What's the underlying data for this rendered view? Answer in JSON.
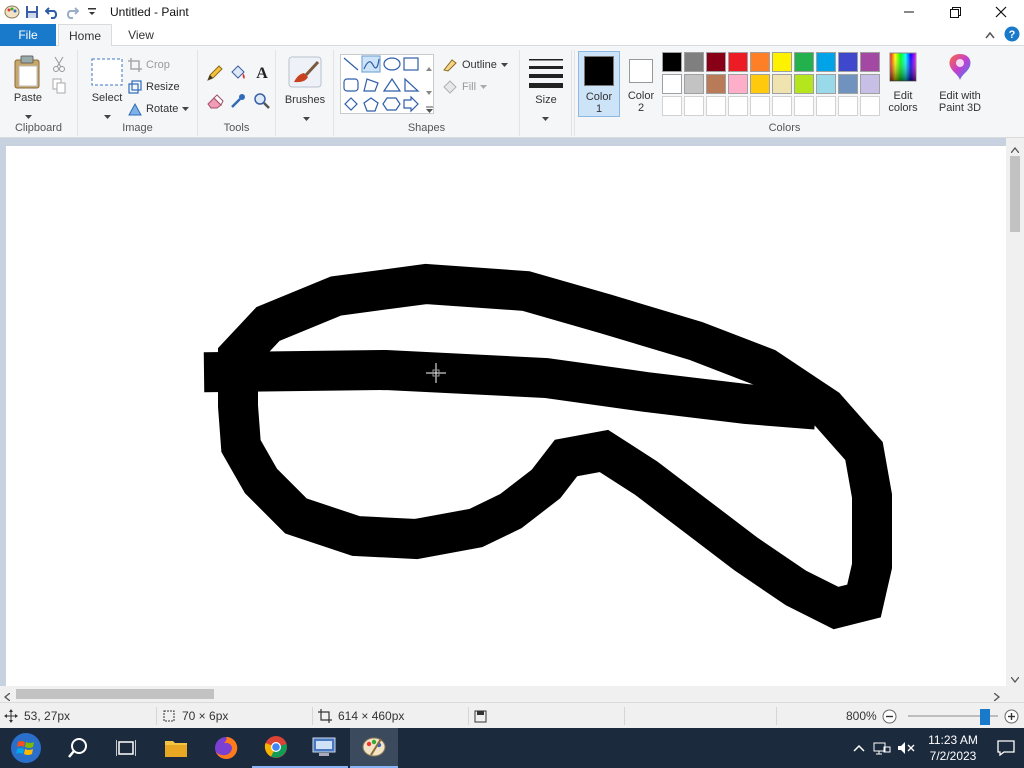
{
  "window": {
    "title": "Untitled - Paint"
  },
  "tabs": {
    "file": "File",
    "home": "Home",
    "view": "View"
  },
  "ribbon": {
    "clipboard": {
      "label": "Clipboard",
      "paste": "Paste"
    },
    "image": {
      "label": "Image",
      "select": "Select",
      "crop": "Crop",
      "resize": "Resize",
      "rotate": "Rotate"
    },
    "tools": {
      "label": "Tools"
    },
    "brushes": {
      "label": "Brushes"
    },
    "shapes": {
      "label": "Shapes",
      "outline": "Outline",
      "fill": "Fill"
    },
    "size": {
      "label": "Size"
    },
    "color1": {
      "label": "Color 1",
      "line1": "Color",
      "line2": "1",
      "value": "#000000"
    },
    "color2": {
      "label": "Color 2",
      "line1": "Color",
      "line2": "2",
      "value": "#ffffff"
    },
    "colors": {
      "label": "Colors",
      "row1": [
        "#000000",
        "#7f7f7f",
        "#880015",
        "#ed1c24",
        "#ff7f27",
        "#fff200",
        "#22b14c",
        "#00a2e8",
        "#3f48cc",
        "#a349a4"
      ],
      "row2": [
        "#ffffff",
        "#c3c3c3",
        "#b97a57",
        "#ffaec9",
        "#ffc90e",
        "#efe4b0",
        "#b5e61d",
        "#99d9ea",
        "#7092be",
        "#c8bfe7"
      ]
    },
    "edit_colors": {
      "line1": "Edit",
      "line2": "colors"
    },
    "paint3d": {
      "line1": "Edit with",
      "line2": "Paint 3D"
    }
  },
  "status": {
    "cursor_pos": "53, 27px",
    "selection_size": "70 × 6px",
    "image_size": "614 × 460px",
    "zoom": "800%",
    "zoom_level_fraction": 0.85
  },
  "taskbar": {
    "time": "11:23 AM",
    "date": "7/2/2023"
  }
}
